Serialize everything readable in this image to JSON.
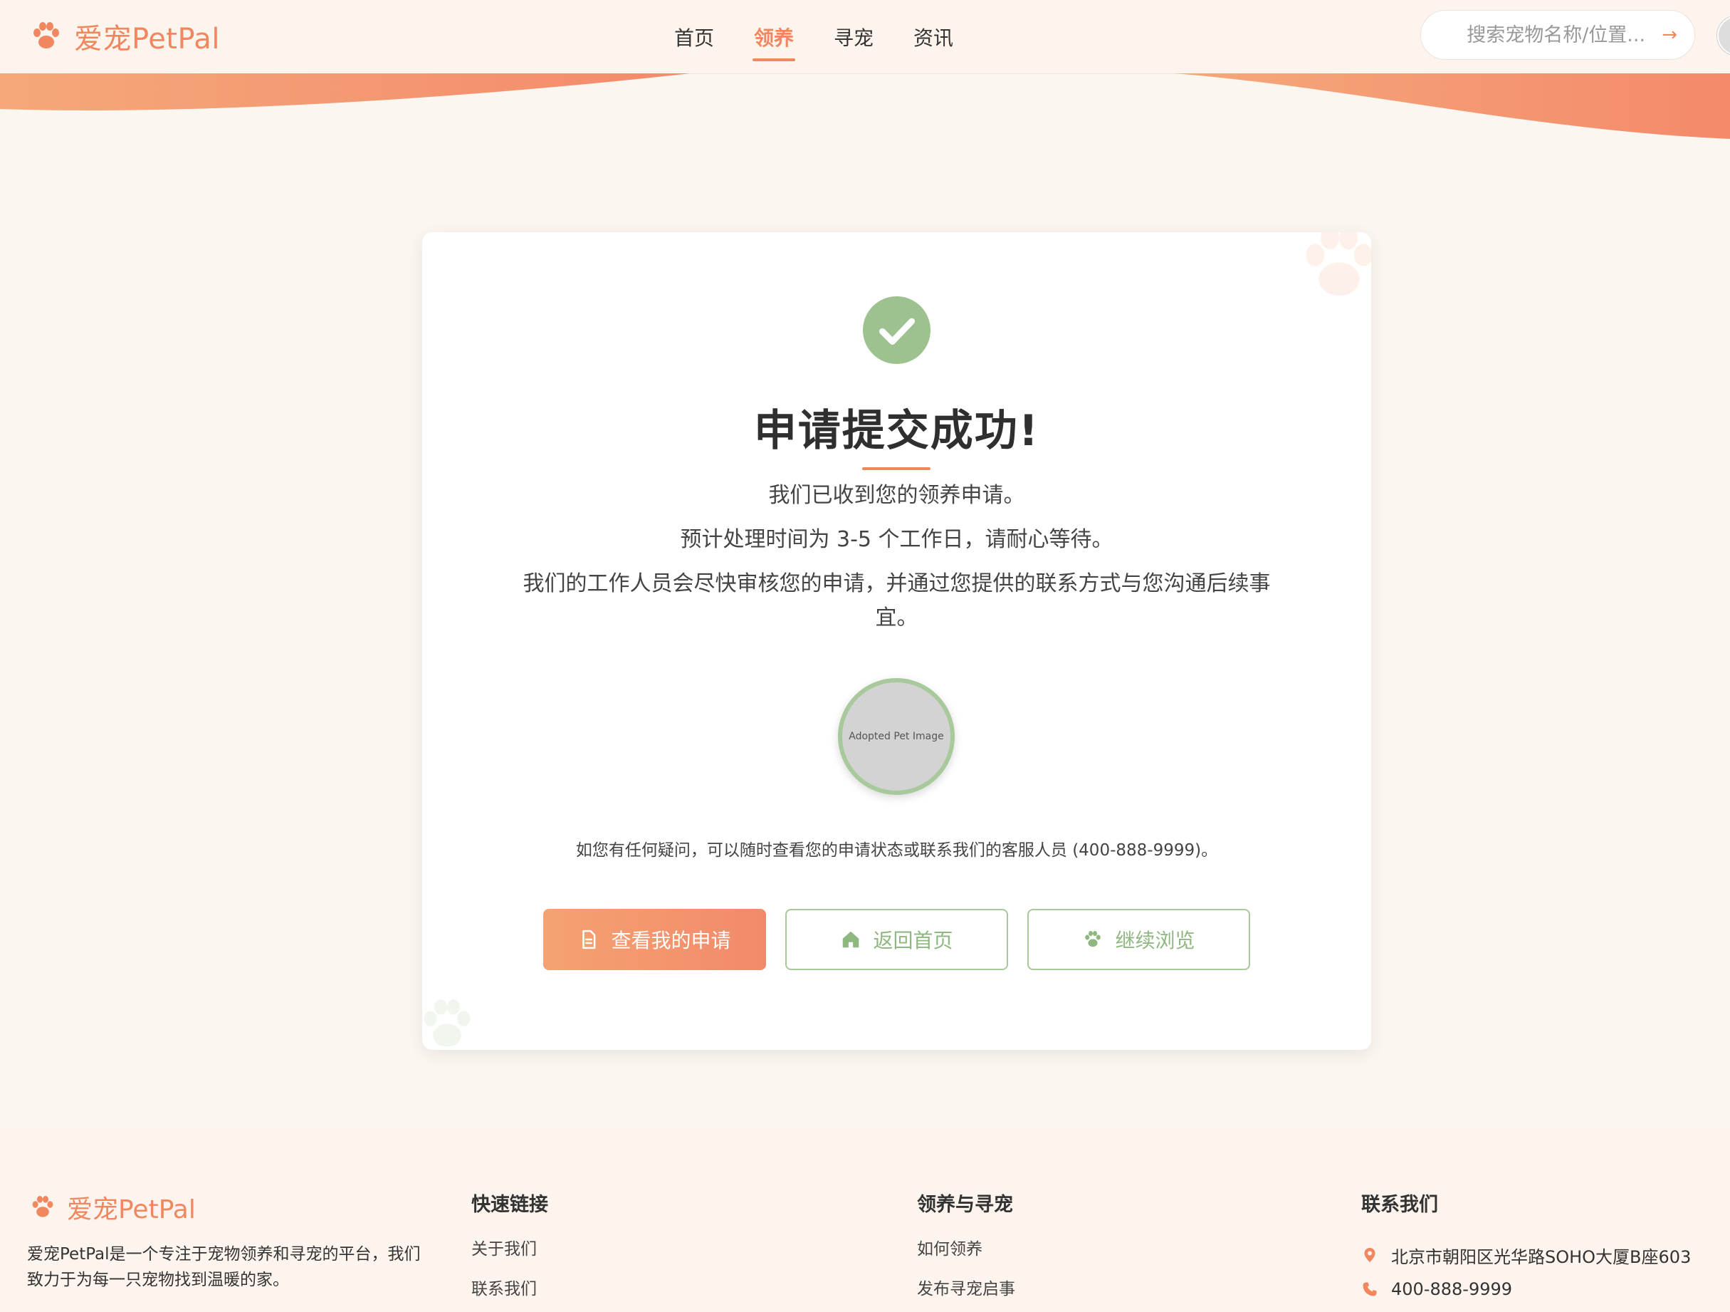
{
  "header": {
    "logo_text": "爱宠PetPal",
    "nav": [
      {
        "label": "首页",
        "active": false
      },
      {
        "label": "领养",
        "active": true
      },
      {
        "label": "寻宠",
        "active": false
      },
      {
        "label": "资讯",
        "active": false
      }
    ],
    "search_placeholder": "搜索宠物名称/位置..."
  },
  "card": {
    "title": "申请提交成功!",
    "message_1": "我们已收到您的领养申请。",
    "message_2": "预计处理时间为 3-5 个工作日，请耐心等待。",
    "message_3": "我们的工作人员会尽快审核您的申请，并通过您提供的联系方式与您沟通后续事宜。",
    "pet_image_label": "Adopted Pet Image",
    "help_text": "如您有任何疑问，可以随时查看您的申请状态或联系我们的客服人员 (400-888-9999)。",
    "buttons": {
      "view_application": "查看我的申请",
      "back_home": "返回首页",
      "continue_browsing": "继续浏览"
    }
  },
  "footer": {
    "logo_text": "爱宠PetPal",
    "description": "爱宠PetPal是一个专注于宠物领养和寻宠的平台，我们致力于为每一只宠物找到温暖的家。",
    "quick_links": {
      "heading": "快速链接",
      "items": [
        "关于我们",
        "联系我们"
      ]
    },
    "adopt_find": {
      "heading": "领养与寻宠",
      "items": [
        "如何领养",
        "发布寻宠启事"
      ]
    },
    "contact": {
      "heading": "联系我们",
      "address": "北京市朝阳区光华路SOHO大厦B座603",
      "phone": "400-888-9999"
    }
  },
  "colors": {
    "accent": "#f0875f",
    "success": "#9ec28f",
    "background": "#fbf6f0"
  },
  "icons": [
    "paw-icon",
    "search-arrow-icon",
    "check-icon",
    "document-icon",
    "home-icon",
    "location-icon",
    "phone-icon"
  ]
}
